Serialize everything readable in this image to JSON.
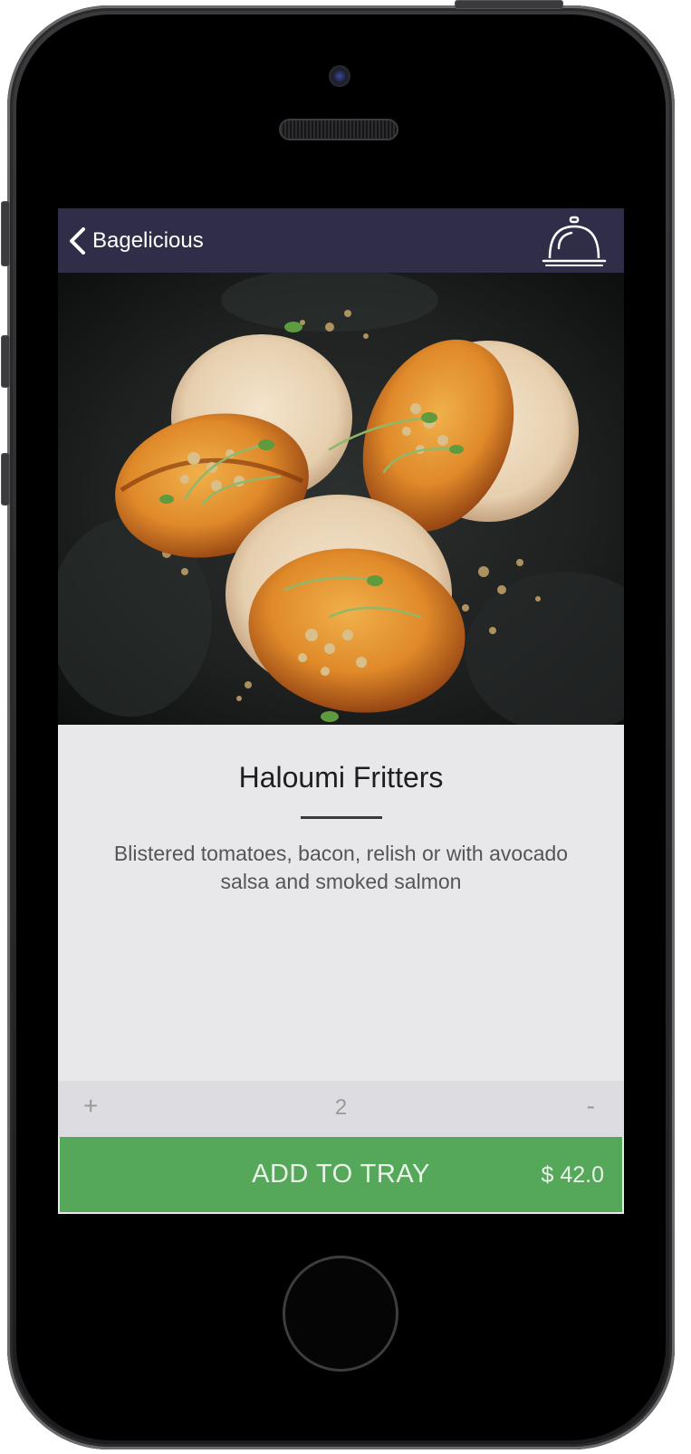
{
  "navbar": {
    "back_label": "Bagelicious",
    "back_icon": "chevron-left-icon",
    "tray_icon": "service-bell-icon",
    "background": "#2f2d48"
  },
  "item": {
    "title": "Haloumi Fritters",
    "description": "Blistered tomatoes, bacon, relish or with avocado salsa and smoked salmon"
  },
  "quantity": {
    "increment_label": "+",
    "value": "2",
    "decrement_label": "-"
  },
  "add_to_tray": {
    "label": "ADD TO TRAY",
    "price": "$ 42.0",
    "color": "#55a75a"
  }
}
